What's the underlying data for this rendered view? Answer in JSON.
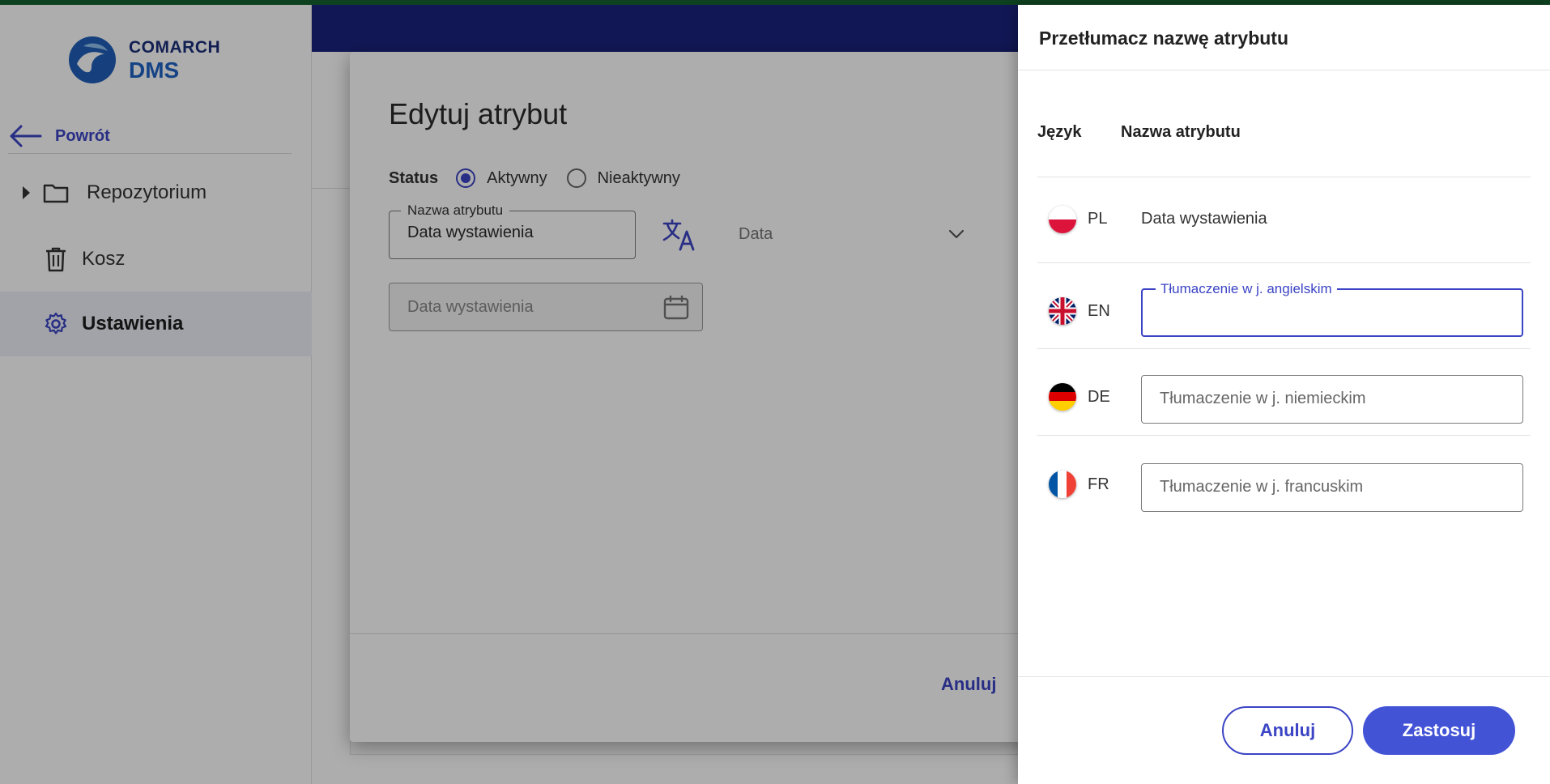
{
  "logo": {
    "line1": "COMARCH",
    "line2": "DMS"
  },
  "sidebar": {
    "back_label": "Powrót",
    "items": [
      {
        "label": "Repozytorium",
        "icon": "folder-icon"
      },
      {
        "label": "Kosz",
        "icon": "trash-icon"
      },
      {
        "label": "Ustawienia",
        "icon": "gear-icon",
        "active": true
      }
    ]
  },
  "edit_dialog": {
    "title": "Edytuj atrybut",
    "status_label": "Status",
    "status_options": [
      "Aktywny",
      "Nieaktywny"
    ],
    "status_selected": "Aktywny",
    "name_field": {
      "legend": "Nazwa atrybutu",
      "value": "Data wystawienia"
    },
    "translate_icon": "translate-icon",
    "type_select": {
      "value": "Data"
    },
    "date_field": {
      "placeholder": "Data wystawienia",
      "icon": "calendar-icon"
    },
    "cancel_label": "Anuluj"
  },
  "translate_panel": {
    "title": "Przetłumacz nazwę atrybutu",
    "col_language": "Język",
    "col_name": "Nazwa atrybutu",
    "rows": [
      {
        "code": "PL",
        "value": "Data wystawienia"
      },
      {
        "code": "EN",
        "legend": "Tłumaczenie w j. angielskim",
        "value": ""
      },
      {
        "code": "DE",
        "placeholder": "Tłumaczenie w j. niemieckim"
      },
      {
        "code": "FR",
        "placeholder": "Tłumaczenie w j. francuskim"
      }
    ],
    "cancel_label": "Anuluj",
    "apply_label": "Zastosuj"
  },
  "colors": {
    "accent": "#3b44c4",
    "topbar": "#1a237e",
    "apply": "#4353d6"
  }
}
